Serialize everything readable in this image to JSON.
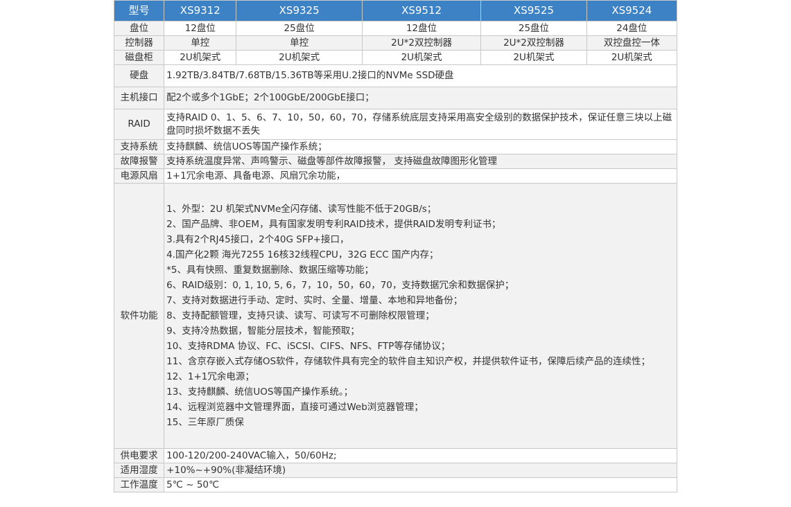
{
  "header": {
    "label": "型号",
    "models": [
      "XS9312",
      "XS9325",
      "XS9512",
      "XS9525",
      "XS9524"
    ]
  },
  "rows_multi": [
    {
      "label": "盘位",
      "values": [
        "12盘位",
        "25盘位",
        "12盘位",
        "25盘位",
        "24盘位"
      ]
    },
    {
      "label": "控制器",
      "values": [
        "单控",
        "单控",
        "2U*2双控制器",
        "2U*2双控制器",
        "双控盘控一体"
      ]
    },
    {
      "label": "磁盘柜",
      "values": [
        "2U机架式",
        "2U机架式",
        "2U机架式",
        "2U机架式",
        "2U机架式"
      ]
    }
  ],
  "disk": {
    "label": "硬盘",
    "value": "1.92TB/3.84TB/7.68TB/15.36TB等采用U.2接口的NVMe SSD硬盘"
  },
  "host_interface": {
    "label": "主机接口",
    "value": "配2个或多个1GbE；2个100GbE/200GbE接口；"
  },
  "raid": {
    "label": "RAID",
    "value": "支持RAID 0、1、5、6、7、10，50，60，70，存储系统底层支持采用高安全级别的数据保护技术，保证任意三块以上磁盘同时损坏数据不丢失"
  },
  "os_support": {
    "label": "支持系统",
    "value": "支持麒麟、统信UOS等国产操作系统；"
  },
  "fault_alarm": {
    "label": "故障报警",
    "value": "支持系统温度异常、声鸣警示、磁盘等部件故障报警， 支持磁盘故障图形化管理"
  },
  "power_fan": {
    "label": "电源风扇",
    "value": "1+1冗余电源、具备电源、风扇冗余功能，"
  },
  "software": {
    "label": "软件功能",
    "lines": [
      "1、外型：2U 机架式NVMe全闪存储、读写性能不低于20GB/s；",
      "2、国产品牌、非OEM，具有国家发明专利RAID技术，提供RAID发明专利证书；",
      "3.具有2个RJ45接口，2个40G SFP+接口，",
      "4.国产化2颗 海光7255 16核32线程CPU，32G ECC 国产内存；",
      "*5、具有快照、重复数据删除、数据压缩等功能；",
      "6、RAID级别：0, 1, 10, 5, 6，7，10，50，60，70，支持数据冗余和数据保护；",
      "7、支持对数据进行手动、定时、实时、全量、增量、本地和异地备份；",
      "8、支持配额管理，支持只读、读写、可读写不可删除权限管理；",
      "9、支持冷热数据，智能分层技术，智能预取；",
      "10、支持RDMA 协议、FC、iSCSI、CIFS、NFS、FTP等存储协议；",
      "11、含京存嵌入式存储OS软件，存储软件具有完全的软件自主知识产权，并提供软件证书，保障后续产品的连续性；",
      "12、1+1冗余电源；",
      "13、支持麒麟、统信UOS等国产操作系统。；",
      "14、远程浏览器中文管理界面，直接可通过Web浏览器管理；",
      "15、三年原厂质保"
    ]
  },
  "power_supply": {
    "label": "供电要求",
    "value": "100-120/200-240VAC输入，50/60Hz;"
  },
  "humidity": {
    "label": "适用湿度",
    "value": "+10%~+90%(非凝结环境)"
  },
  "temperature": {
    "label": "工作温度",
    "value": "5℃ ~ 50℃"
  },
  "colors": {
    "header_bg": "#3d82c4",
    "header_text": "#ffffff",
    "label_bg": "#f2f2f2",
    "border": "#c8c8c8"
  }
}
